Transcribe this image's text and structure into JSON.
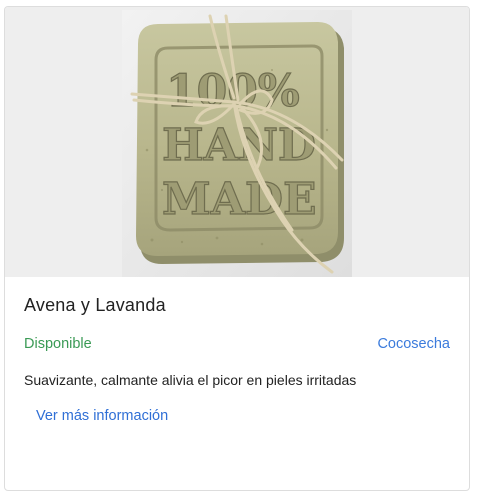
{
  "product": {
    "title": "Avena y Lavanda",
    "status": "Disponible",
    "vendor": "Cocosecha",
    "description": "Suavizante, calmante alivia el picor en pieles irritadas",
    "more_info_label": "Ver más información",
    "image": {
      "stamp_text": [
        "100%",
        "HAND",
        "MADE"
      ],
      "colors": {
        "background": "#eeeeee",
        "soap": "#b9b98f",
        "soap_shadow": "#8f8e6a",
        "twine": "#ddd2b2"
      }
    }
  },
  "colors": {
    "status": "#3a9a55",
    "link": "#3b7bdc",
    "text": "#222222",
    "border": "#dddddd"
  }
}
